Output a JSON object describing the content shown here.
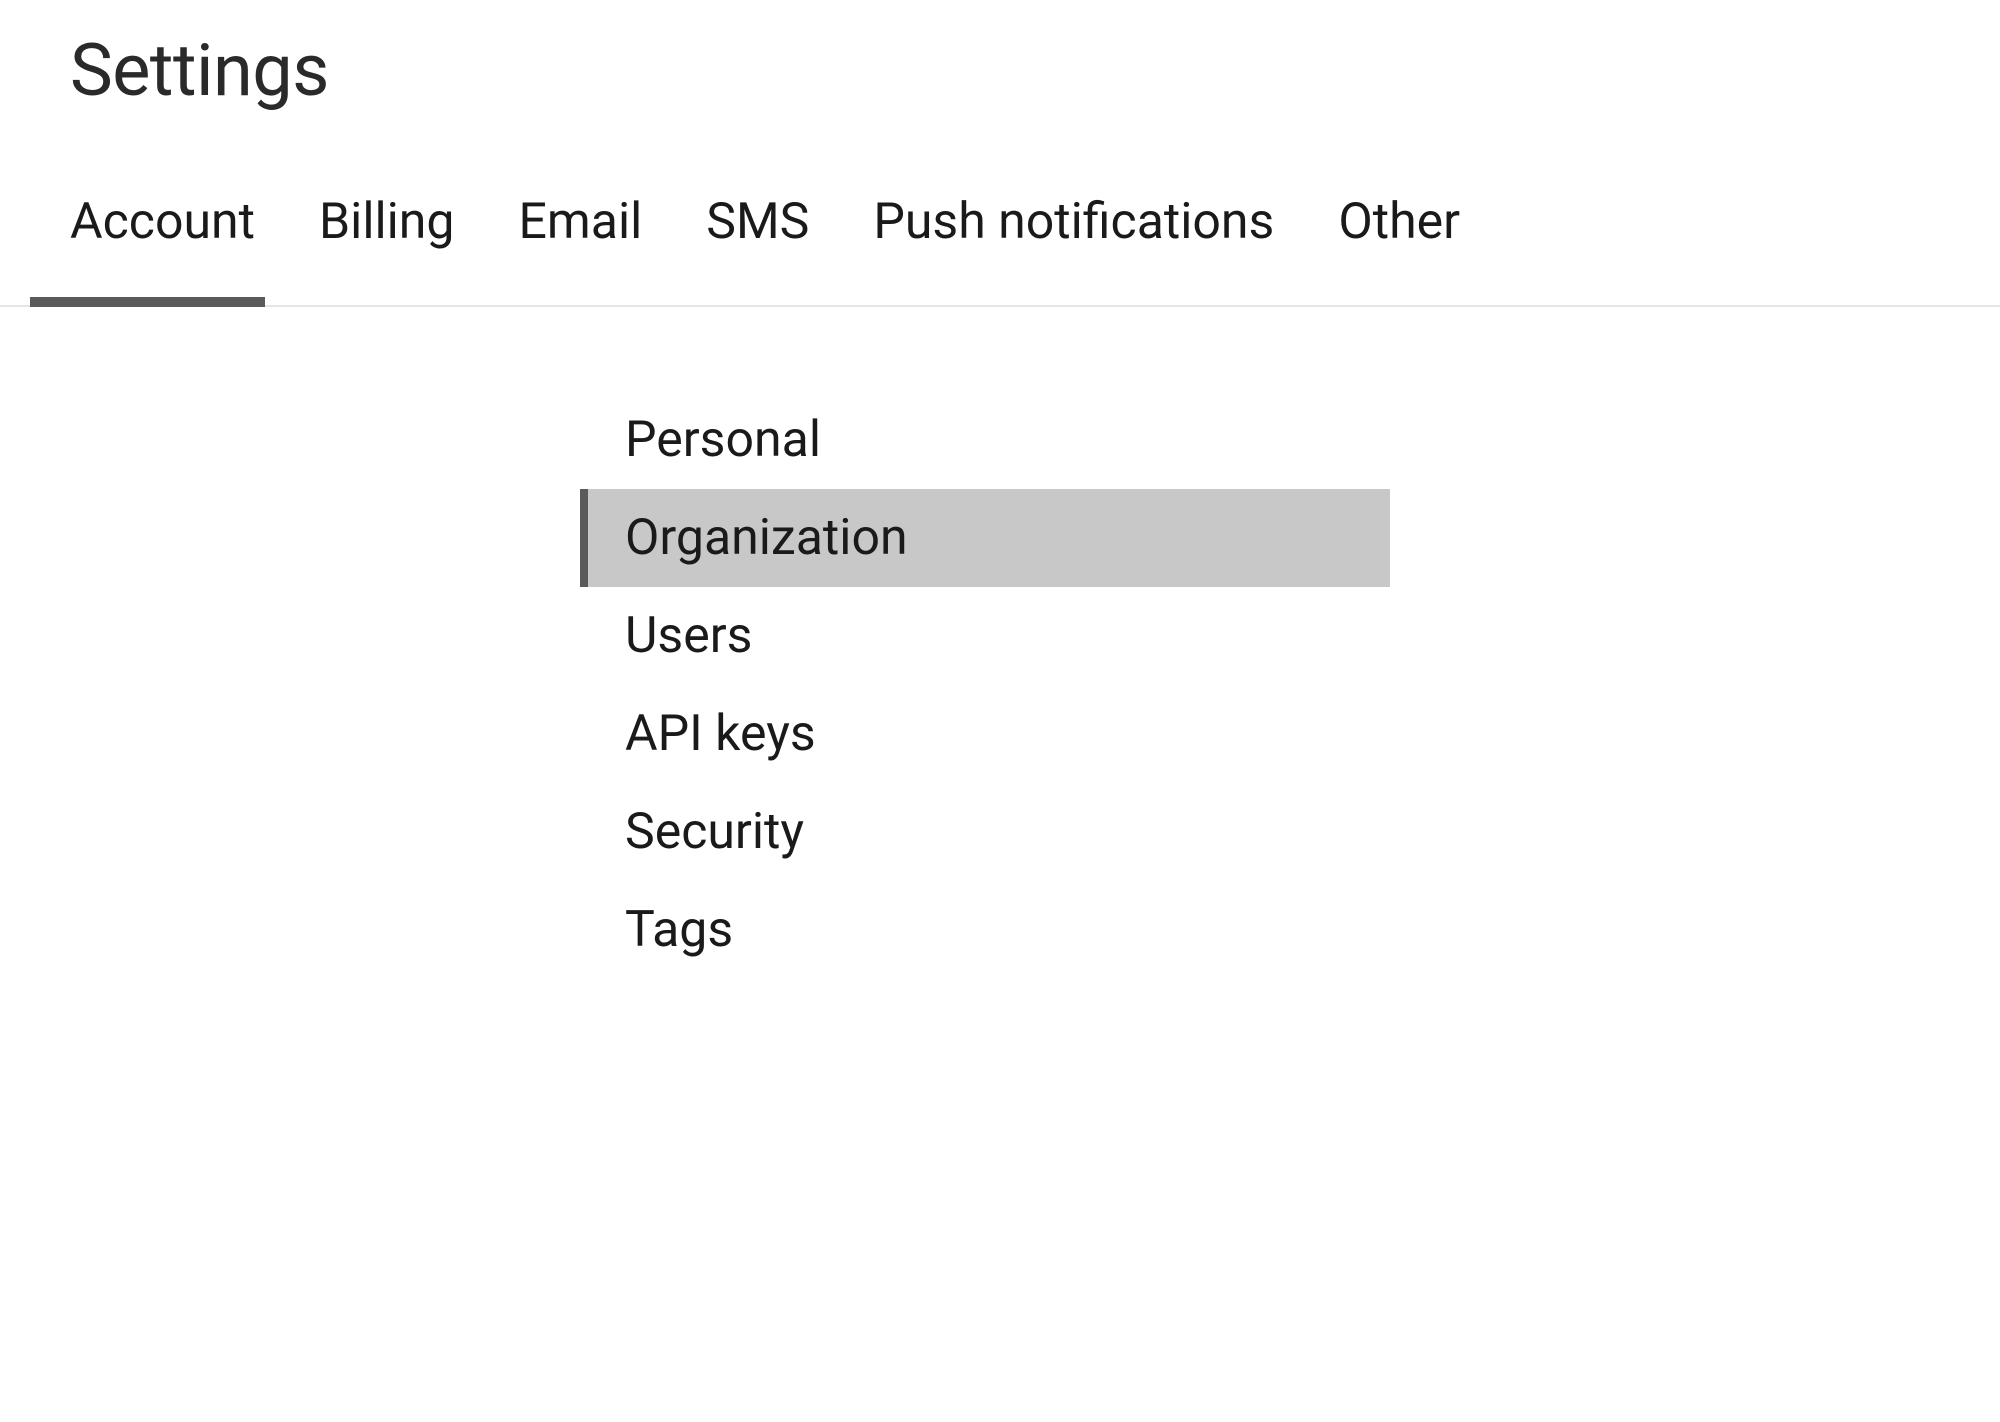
{
  "page": {
    "title": "Settings"
  },
  "tabs": [
    {
      "label": "Account",
      "active": true
    },
    {
      "label": "Billing",
      "active": false
    },
    {
      "label": "Email",
      "active": false
    },
    {
      "label": "SMS",
      "active": false
    },
    {
      "label": "Push notifications",
      "active": false
    },
    {
      "label": "Other",
      "active": false
    }
  ],
  "sidebar": {
    "items": [
      {
        "label": "Personal",
        "selected": false
      },
      {
        "label": "Organization",
        "selected": true
      },
      {
        "label": "Users",
        "selected": false
      },
      {
        "label": "API keys",
        "selected": false
      },
      {
        "label": "Security",
        "selected": false
      },
      {
        "label": "Tags",
        "selected": false
      }
    ]
  }
}
